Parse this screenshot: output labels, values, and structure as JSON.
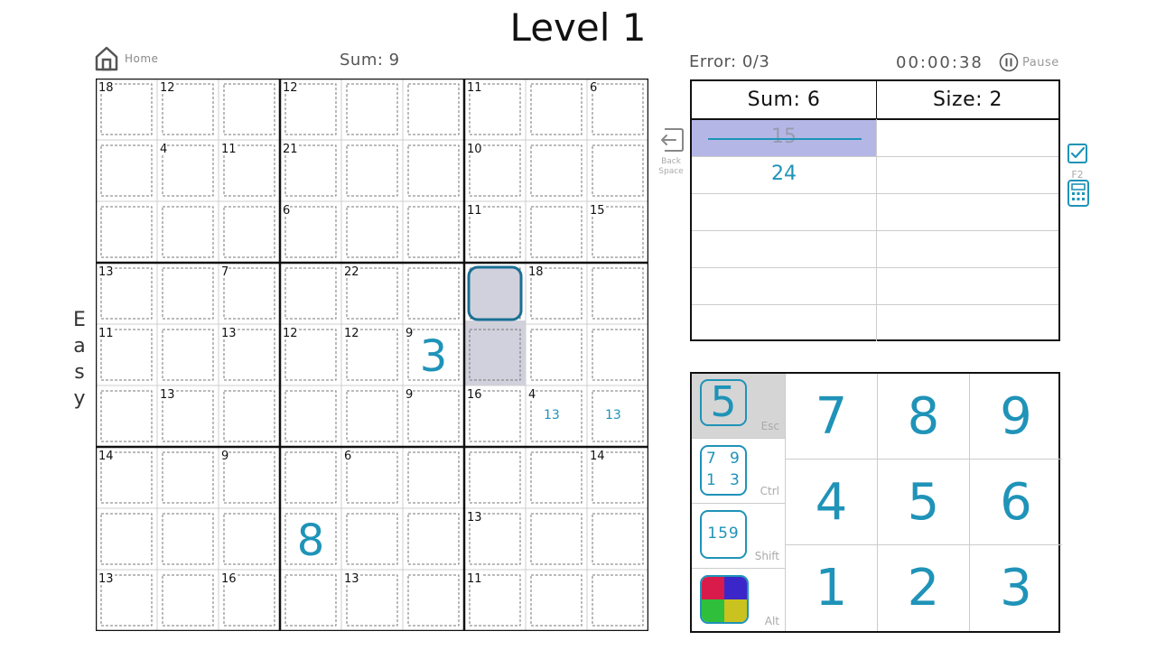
{
  "title": "Level 1",
  "home": {
    "label": "Home",
    "icon": "home-icon"
  },
  "sum_display": "Sum: 9",
  "error_display": "Error: 0/3",
  "timer": "00:00:38",
  "pause": {
    "label": "Pause",
    "icon": "pause-icon"
  },
  "difficulty": [
    "E",
    "a",
    "s",
    "y"
  ],
  "board": {
    "cage_sums": [
      {
        "r": 0,
        "c": 0,
        "sum": "18"
      },
      {
        "r": 0,
        "c": 1,
        "sum": "12"
      },
      {
        "r": 0,
        "c": 3,
        "sum": "12"
      },
      {
        "r": 0,
        "c": 6,
        "sum": "11"
      },
      {
        "r": 0,
        "c": 8,
        "sum": "6"
      },
      {
        "r": 1,
        "c": 1,
        "sum": "4"
      },
      {
        "r": 1,
        "c": 2,
        "sum": "11"
      },
      {
        "r": 1,
        "c": 3,
        "sum": "21"
      },
      {
        "r": 1,
        "c": 6,
        "sum": "10"
      },
      {
        "r": 2,
        "c": 3,
        "sum": "6"
      },
      {
        "r": 2,
        "c": 6,
        "sum": "11"
      },
      {
        "r": 2,
        "c": 8,
        "sum": "15"
      },
      {
        "r": 3,
        "c": 0,
        "sum": "13"
      },
      {
        "r": 3,
        "c": 2,
        "sum": "7"
      },
      {
        "r": 3,
        "c": 4,
        "sum": "22"
      },
      {
        "r": 3,
        "c": 7,
        "sum": "18"
      },
      {
        "r": 4,
        "c": 0,
        "sum": "11"
      },
      {
        "r": 4,
        "c": 2,
        "sum": "13"
      },
      {
        "r": 4,
        "c": 3,
        "sum": "12"
      },
      {
        "r": 4,
        "c": 4,
        "sum": "12"
      },
      {
        "r": 4,
        "c": 5,
        "sum": "9"
      },
      {
        "r": 5,
        "c": 1,
        "sum": "13"
      },
      {
        "r": 5,
        "c": 5,
        "sum": "9"
      },
      {
        "r": 5,
        "c": 6,
        "sum": "16"
      },
      {
        "r": 5,
        "c": 7,
        "sum": "4"
      },
      {
        "r": 6,
        "c": 0,
        "sum": "14"
      },
      {
        "r": 6,
        "c": 2,
        "sum": "9"
      },
      {
        "r": 6,
        "c": 4,
        "sum": "6"
      },
      {
        "r": 6,
        "c": 8,
        "sum": "14"
      },
      {
        "r": 7,
        "c": 6,
        "sum": "13"
      },
      {
        "r": 8,
        "c": 0,
        "sum": "13"
      },
      {
        "r": 8,
        "c": 2,
        "sum": "16"
      },
      {
        "r": 8,
        "c": 4,
        "sum": "13"
      },
      {
        "r": 8,
        "c": 6,
        "sum": "11"
      }
    ],
    "digits": [
      {
        "r": 4,
        "c": 5,
        "value": "3"
      },
      {
        "r": 7,
        "c": 3,
        "value": "8"
      }
    ],
    "candidates": [
      {
        "r": 5,
        "c": 7,
        "value": "13"
      },
      {
        "r": 5,
        "c": 8,
        "value": "13"
      }
    ],
    "selected": {
      "r": 3,
      "c": 6
    },
    "highlighted": [
      {
        "r": 4,
        "c": 6
      }
    ],
    "colors": {
      "digit": "#1f93b8",
      "selection_border": "#1a6f94",
      "highlight": "#d1d1dd"
    }
  },
  "hint_table": {
    "sum_header": "Sum: 6",
    "size_header": "Size: 2",
    "combos": [
      {
        "value": "15",
        "struck": true
      },
      {
        "value": "24",
        "struck": false
      }
    ],
    "strike_color": "#1f93b8",
    "struck_bg": "#b4b7e6"
  },
  "backspace": {
    "label_line1": "Back",
    "label_line2": "Space",
    "icon": "backspace-icon"
  },
  "f2": {
    "label": "F2",
    "icon": "checkbox-icon"
  },
  "calculator": {
    "icon": "calculator-icon"
  },
  "keypad": {
    "modes": [
      {
        "key": "Esc",
        "sample": "5",
        "active": true,
        "name": "normal"
      },
      {
        "key": "Ctrl",
        "sample": [
          "7",
          "9",
          "1",
          "3"
        ],
        "name": "corner"
      },
      {
        "key": "Shift",
        "sample": "159",
        "name": "center"
      },
      {
        "key": "Alt",
        "colors": [
          "#d81b4a",
          "#3b27c9",
          "#2fbf3b",
          "#c9c21f"
        ],
        "name": "color"
      }
    ],
    "numbers": [
      "7",
      "8",
      "9",
      "4",
      "5",
      "6",
      "1",
      "2",
      "3"
    ]
  }
}
